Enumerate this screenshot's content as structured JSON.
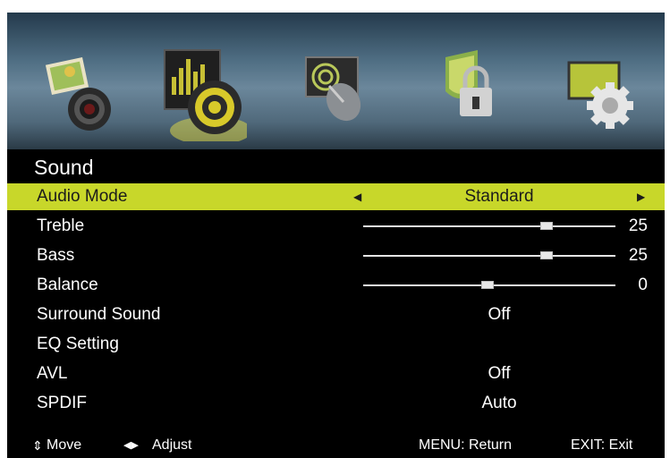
{
  "menu": {
    "title": "Sound",
    "icons": [
      "picture-icon",
      "sound-icon",
      "channel-icon",
      "lock-icon",
      "setup-icon"
    ],
    "active_icon": "sound-icon",
    "items": [
      {
        "label": "Audio Mode",
        "value": "Standard",
        "type": "select",
        "selected": true
      },
      {
        "label": "Treble",
        "value": "25",
        "type": "slider",
        "level": 0.73
      },
      {
        "label": "Bass",
        "value": "25",
        "type": "slider",
        "level": 0.73
      },
      {
        "label": "Balance",
        "value": "0",
        "type": "slider",
        "level": 0.5
      },
      {
        "label": "Surround Sound",
        "value": "Off",
        "type": "value"
      },
      {
        "label": "EQ Setting",
        "value": "",
        "type": "submenu"
      },
      {
        "label": "AVL",
        "value": "Off",
        "type": "value"
      },
      {
        "label": "SPDIF",
        "value": "Auto",
        "type": "value"
      }
    ]
  },
  "footer": {
    "move": "Move",
    "adjust": "Adjust",
    "menu_return": "MENU: Return",
    "exit": "EXIT: Exit"
  },
  "colors": {
    "highlight": "#c8d72a",
    "background": "#000000",
    "text": "#ffffff"
  }
}
